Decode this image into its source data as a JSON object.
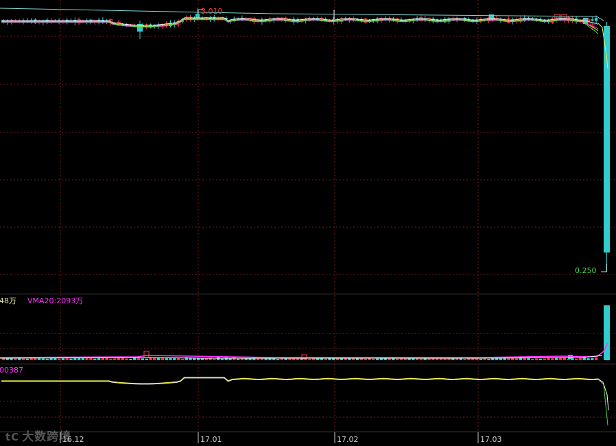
{
  "colors": {
    "background": "#000000",
    "grid": "#7a1a1a",
    "up": "#ff3b3b",
    "down": "#33cccc",
    "ma_white": "#f2f2f2",
    "ma_yellow": "#e8e84a",
    "ma_magenta": "#ff33ff",
    "ma_green": "#44dd44",
    "vol_label": "#e8e8a0",
    "vma_label": "#ff33ff",
    "ind_label": "#ff33ff",
    "price_max_label": "#ff3b3b",
    "price_min_label": "#44dd44",
    "axis_label": "#cfcfcf"
  },
  "chart_data": [
    {
      "type": "candlestick",
      "panel": "price",
      "annotations": [
        {
          "text": "3.010",
          "kind": "high"
        },
        {
          "text": "0.250",
          "kind": "low"
        }
      ],
      "x": [
        "16.12",
        "17.01",
        "17.02",
        "17.03"
      ],
      "ylim": [
        0.25,
        3.01
      ],
      "grid": true
    },
    {
      "type": "bar",
      "panel": "volume",
      "labels": {
        "vol": "48万",
        "vma20": "VMA20:2093万"
      }
    },
    {
      "type": "line",
      "panel": "indicator",
      "labels": {
        "value": "00387"
      }
    }
  ],
  "x_axis": {
    "ticks": [
      "16.12",
      "17.01",
      "17.02",
      "17.03"
    ]
  },
  "watermark": {
    "logo": "tC",
    "text": "大数跨境"
  }
}
